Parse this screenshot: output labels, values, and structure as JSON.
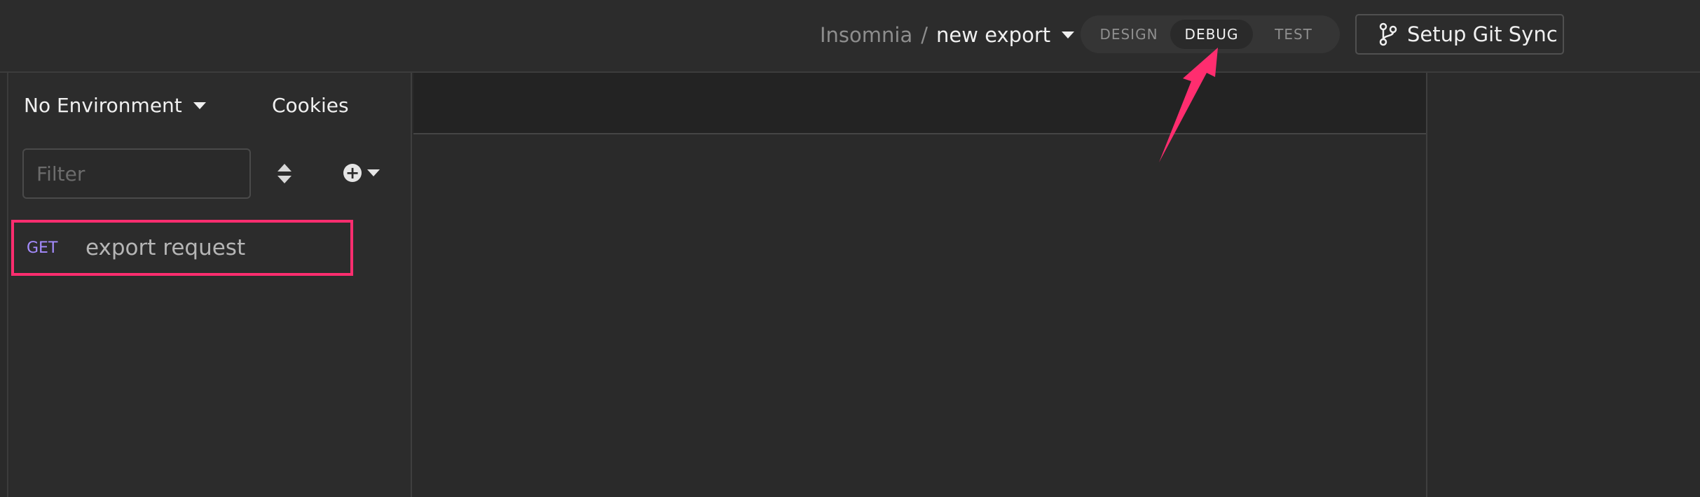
{
  "header": {
    "breadcrumb_root": "Insomnia",
    "breadcrumb_sep": "/",
    "workspace_name": "new export",
    "modes": [
      "DESIGN",
      "DEBUG",
      "TEST"
    ],
    "active_mode": "DEBUG",
    "git_button_label": "Setup Git Sync"
  },
  "sidebar": {
    "environment_label": "No Environment",
    "cookies_label": "Cookies",
    "filter_placeholder": "Filter",
    "requests": [
      {
        "method": "GET",
        "name": "export request"
      }
    ]
  },
  "colors": {
    "accent_highlight": "#ff2d6f",
    "method_get": "#a58cff",
    "background": "#2a2a2a"
  }
}
